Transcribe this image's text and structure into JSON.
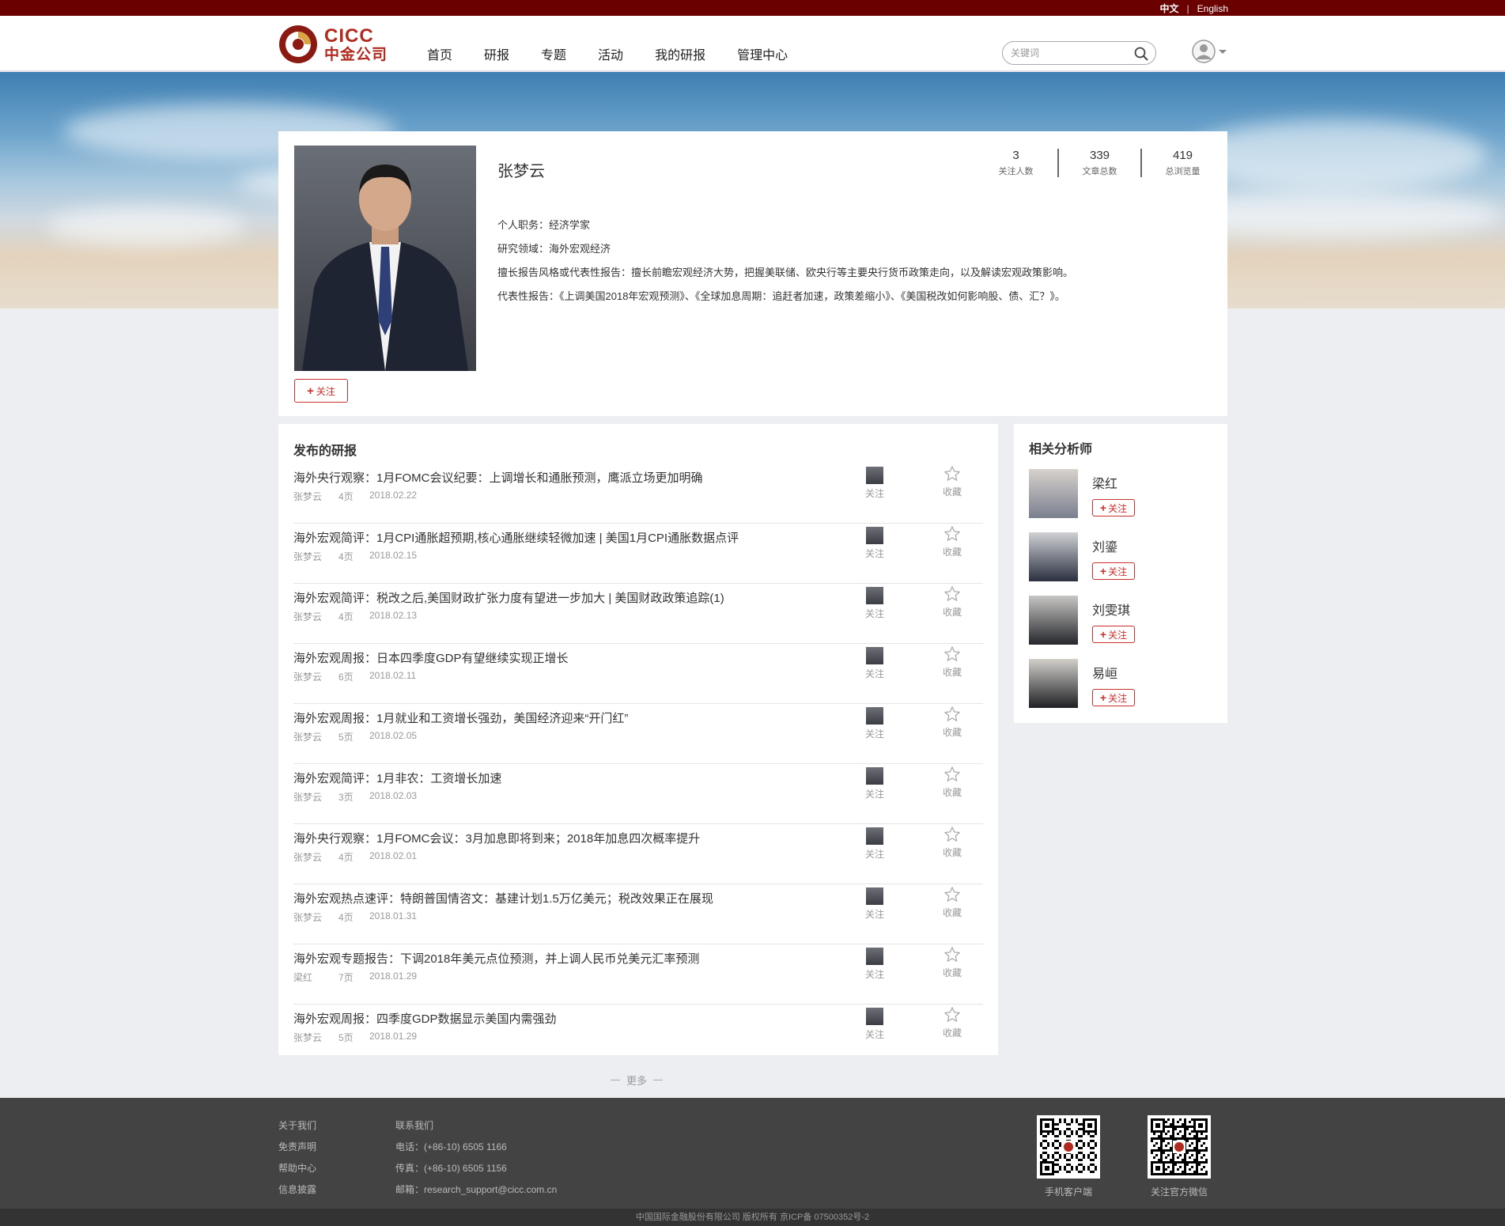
{
  "topbar": {
    "lang_current": "中文",
    "lang_sep": "|",
    "lang_other": "English"
  },
  "header": {
    "logo_en": "CICC",
    "logo_cn": "中金公司",
    "nav": [
      "首页",
      "研报",
      "专题",
      "活动",
      "我的研报",
      "管理中心"
    ],
    "search_placeholder": "关键词"
  },
  "profile": {
    "name": "张梦云",
    "follow_label": "关注",
    "stats": [
      {
        "value": "3",
        "label": "关注人数"
      },
      {
        "value": "339",
        "label": "文章总数"
      },
      {
        "value": "419",
        "label": "总浏览量"
      }
    ],
    "info": [
      "个人职务：经济学家",
      "研究领域：海外宏观经济",
      "擅长报告风格或代表性报告：擅长前瞻宏观经济大势，把握美联储、欧央行等主要央行货币政策走向，以及解读宏观政策影响。",
      "代表性报告：《上调美国2018年宏观预测》、《全球加息周期：追赶者加速，政策差缩小》、《美国税改如何影响股、债、汇？》。"
    ]
  },
  "reports": {
    "title": "发布的研报",
    "follow_label": "关注",
    "star_label": "收藏",
    "items": [
      {
        "title": "海外央行观察：1月FOMC会议纪要：上调增长和通胀预测，鹰派立场更加明确",
        "author": "张梦云",
        "pages": "4页",
        "date": "2018.02.22"
      },
      {
        "title": "海外宏观简评：1月CPI通胀超预期,核心通胀继续轻微加速 | 美国1月CPI通胀数据点评",
        "author": "张梦云",
        "pages": "4页",
        "date": "2018.02.15"
      },
      {
        "title": "海外宏观简评：税改之后,美国财政扩张力度有望进一步加大 | 美国财政政策追踪(1)",
        "author": "张梦云",
        "pages": "4页",
        "date": "2018.02.13"
      },
      {
        "title": "海外宏观周报：日本四季度GDP有望继续实现正增长",
        "author": "张梦云",
        "pages": "6页",
        "date": "2018.02.11"
      },
      {
        "title": "海外宏观周报：1月就业和工资增长强劲，美国经济迎来“开门红”",
        "author": "张梦云",
        "pages": "5页",
        "date": "2018.02.05"
      },
      {
        "title": "海外宏观简评：1月非农：工资增长加速",
        "author": "张梦云",
        "pages": "3页",
        "date": "2018.02.03"
      },
      {
        "title": "海外央行观察：1月FOMC会议：3月加息即将到来；2018年加息四次概率提升",
        "author": "张梦云",
        "pages": "4页",
        "date": "2018.02.01"
      },
      {
        "title": "海外宏观热点速评：特朗普国情咨文：基建计划1.5万亿美元；税改效果正在展现",
        "author": "张梦云",
        "pages": "4页",
        "date": "2018.01.31"
      },
      {
        "title": "海外宏观专题报告：下调2018年美元点位预测，并上调人民币兑美元汇率预测",
        "author": "梁红",
        "pages": "7页",
        "date": "2018.01.29"
      },
      {
        "title": "海外宏观周报：四季度GDP数据显示美国内需强劲",
        "author": "张梦云",
        "pages": "5页",
        "date": "2018.01.29"
      }
    ],
    "more_label": "更多"
  },
  "related": {
    "title": "相关分析师",
    "follow_label": "关注",
    "analysts": [
      {
        "name": "梁红"
      },
      {
        "name": "刘鎏"
      },
      {
        "name": "刘雯琪"
      },
      {
        "name": "易峘"
      }
    ]
  },
  "footer": {
    "links": [
      "关于我们",
      "免责声明",
      "帮助中心",
      "信息披露"
    ],
    "contact": [
      "联系我们",
      "电话：(+86-10) 6505 1166",
      "传真：(+86-10) 6505 1156",
      "邮箱：research_support@cicc.com.cn"
    ],
    "qr_client": "手机客户端",
    "qr_wechat": "关注官方微信",
    "copyright": "中国国际金融股份有限公司 版权所有 京ICP备 07500352号-2"
  },
  "colors": {
    "brand_dark_red": "#6b0000",
    "brand_red": "#b22a1e",
    "follow_red": "#c9302c"
  }
}
